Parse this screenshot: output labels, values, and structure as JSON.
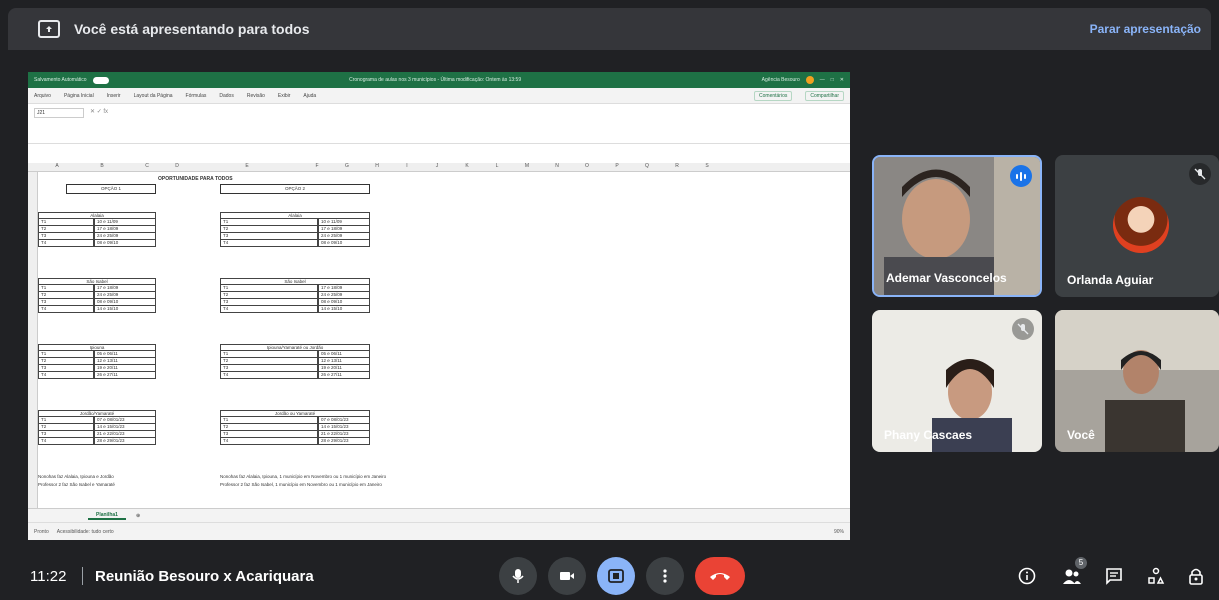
{
  "presentation_bar": {
    "status": "Você está apresentando para todos",
    "stop_label": "Parar apresentação"
  },
  "excel": {
    "title_left": "Salvamento Automático",
    "title_center": "Cronograma de aulas nos 3 municípios - Última modificação: Ontem às 13:59",
    "title_user": "Agência Besouro",
    "menu": [
      "Arquivo",
      "Página Inicial",
      "Inserir",
      "Layout da Página",
      "Fórmulas",
      "Dados",
      "Revisão",
      "Exibir",
      "Ajuda"
    ],
    "comments_btn": "Comentários",
    "share_btn": "Compartilhar",
    "namebox": "J21",
    "columns": [
      "A",
      "B",
      "C",
      "D",
      "E",
      "F",
      "G",
      "H",
      "I",
      "J",
      "K",
      "L",
      "M",
      "N",
      "O",
      "P",
      "Q",
      "R",
      "S"
    ],
    "sheet_title": "OPORTUNIDADE PARA TODOS",
    "option1": "OPÇÃO 1",
    "option2": "OPÇÃO 2",
    "left_blocks": [
      {
        "name": "Alalaia",
        "rows": [
          [
            "T1",
            "10 e 11/09"
          ],
          [
            "T2",
            "17 e 18/09"
          ],
          [
            "T3",
            "24 e 25/09"
          ],
          [
            "T4",
            "08 e 09/10"
          ]
        ]
      },
      {
        "name": "São Isabel",
        "rows": [
          [
            "T1",
            "17 e 18/09"
          ],
          [
            "T2",
            "24 e 25/09"
          ],
          [
            "T3",
            "08 e 09/10"
          ],
          [
            "T4",
            "14 e 15/10"
          ]
        ]
      },
      {
        "name": "Ipiouna",
        "rows": [
          [
            "T1",
            "05 e 06/11"
          ],
          [
            "T2",
            "12 e 13/11"
          ],
          [
            "T3",
            "19 e 20/11"
          ],
          [
            "T4",
            "26 e 27/11"
          ]
        ]
      },
      {
        "name": "Jordão/Yamaraté",
        "rows": [
          [
            "T1",
            "07 e 08/01/23"
          ],
          [
            "T2",
            "14 e 15/01/23"
          ],
          [
            "T3",
            "21 e 22/01/23"
          ],
          [
            "T4",
            "28 e 29/01/23"
          ]
        ]
      }
    ],
    "right_blocks": [
      {
        "name": "Alalaia",
        "rows": [
          [
            "T1",
            "10 e 11/09"
          ],
          [
            "T2",
            "17 e 18/09"
          ],
          [
            "T3",
            "24 e 25/09"
          ],
          [
            "T4",
            "08 e 09/10"
          ]
        ]
      },
      {
        "name": "São Isabel",
        "rows": [
          [
            "T1",
            "17 e 18/09"
          ],
          [
            "T2",
            "24 e 25/09"
          ],
          [
            "T3",
            "08 e 09/10"
          ],
          [
            "T4",
            "14 e 15/10"
          ]
        ]
      },
      {
        "name": "Ipiouna/Yamaraté ou Jordão",
        "rows": [
          [
            "T1",
            "05 e 06/11"
          ],
          [
            "T2",
            "12 e 13/11"
          ],
          [
            "T3",
            "19 e 20/11"
          ],
          [
            "T4",
            "26 e 27/11"
          ]
        ]
      },
      {
        "name": "Jordão ou Yamaraté",
        "rows": [
          [
            "T1",
            "07 e 08/01/23"
          ],
          [
            "T2",
            "14 e 15/01/23"
          ],
          [
            "T3",
            "21 e 22/01/23"
          ],
          [
            "T4",
            "28 e 29/01/23"
          ]
        ]
      }
    ],
    "note_left_1": "Nonohas faz Alalaia, Ipiouna e Jordão",
    "note_left_2": "Professor 2 faz São Isabel e Yamaraté",
    "note_right_1": "Nonohas faz Alalaia, Ipiouna, 1 município em Novembro ou 1 município em Janeiro",
    "note_right_2": "Professor 2 faz São Isabel, 1 município em Novembro ou 1 município em Janeiro",
    "sheet_tab": "Planilha1",
    "status_left": "Pronto",
    "status_access": "Acessibilidade: tudo certo",
    "zoom": "90%"
  },
  "participants": [
    {
      "name": "Ademar Vasconcelos"
    },
    {
      "name": "Orlanda Aguiar"
    },
    {
      "name": "Phany Cascaes"
    },
    {
      "name": "Você"
    }
  ],
  "bottom": {
    "time": "11:22",
    "meeting": "Reunião Besouro x Acariquara",
    "people_count": "5"
  },
  "colors": {
    "accent": "#8ab4f8",
    "hangup": "#ea4335",
    "excel": "#1e7145"
  }
}
